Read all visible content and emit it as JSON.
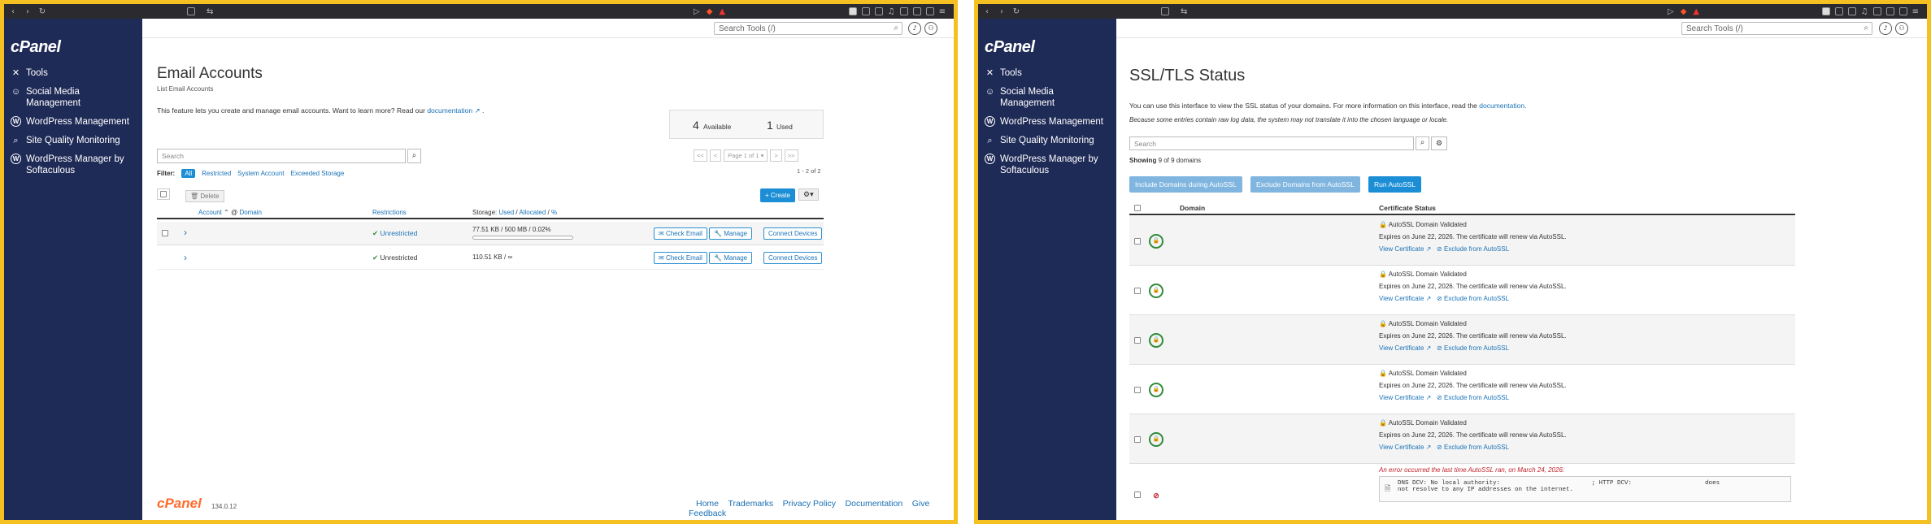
{
  "left": {
    "sidebar": {
      "logo": "cPanel",
      "items": [
        {
          "label": "Tools",
          "icon": "tools-icon"
        },
        {
          "label": "Social Media\nManagement",
          "icon": "social-icon"
        },
        {
          "label": "WordPress Management",
          "icon": "wordpress-icon"
        },
        {
          "label": "Site Quality Monitoring",
          "icon": "search-check-icon"
        },
        {
          "label": "WordPress Manager by\nSoftaculous",
          "icon": "wordpress-icon"
        }
      ]
    },
    "topbar": {
      "search_placeholder": "Search Tools (/)"
    },
    "page": {
      "title": "Email Accounts",
      "subtitle": "List Email Accounts",
      "intro": "This feature lets you create and manage email accounts. Want to learn more? Read our",
      "doc_link": "documentation",
      "stats": {
        "available_num": "4",
        "available_label": "Available",
        "used_num": "1",
        "used_label": "Used"
      },
      "search_placeholder": "Search",
      "pager": {
        "first": "<<",
        "prev": "<",
        "page": "Page 1 of 1",
        "next": ">",
        "last": ">>",
        "range": "1 - 2 of 2"
      },
      "filter_label": "Filter:",
      "filters": [
        "All",
        "Restricted",
        "System Account",
        "Exceeded Storage"
      ],
      "delete_label": "Delete",
      "create_label": "+ Create",
      "columns": {
        "account": "Account",
        "at": "@",
        "domain": "Domain",
        "restrictions": "Restrictions",
        "storage": "Storage:",
        "used": "Used",
        "allocated": "Allocated",
        "pct": "%"
      },
      "rows": [
        {
          "restriction": "Unrestricted",
          "storage": "77.51 KB / 500 MB / 0.02%",
          "has_checkbox": true
        },
        {
          "restriction": "Unrestricted",
          "storage": "110.51 KB / ∞",
          "has_checkbox": false
        }
      ],
      "actions": {
        "check": "Check Email",
        "manage": "Manage",
        "connect": "Connect Devices"
      }
    },
    "footer": {
      "brand": "cPanel",
      "version": "134.0.12",
      "links": [
        "Home",
        "Trademarks",
        "Privacy Policy",
        "Documentation",
        "Give Feedback"
      ]
    }
  },
  "right": {
    "sidebar": {
      "logo": "cPanel",
      "items": [
        {
          "label": "Tools"
        },
        {
          "label": "Social Media\nManagement"
        },
        {
          "label": "WordPress Management"
        },
        {
          "label": "Site Quality Monitoring"
        },
        {
          "label": "WordPress Manager by\nSoftaculous"
        }
      ]
    },
    "topbar": {
      "search_placeholder": "Search Tools (/)"
    },
    "page": {
      "title": "SSL/TLS Status",
      "intro": "You can use this interface to view the SSL status of your domains. For more information on this interface, read the",
      "doc_link": "documentation",
      "note": "Because some entries contain raw log data, the system may not translate it into the chosen language or locale.",
      "search_placeholder": "Search",
      "showing": "Showing",
      "showing_rest": "9 of 9 domains",
      "buttons": [
        "Include Domains during AutoSSL",
        "Exclude Domains from AutoSSL",
        "Run AutoSSL"
      ],
      "col_domain": "Domain",
      "col_status": "Certificate Status",
      "validated": "AutoSSL Domain Validated",
      "expires": "Expires on June 22, 2026. The certificate will renew via AutoSSL.",
      "view_cert": "View Certificate",
      "exclude": "Exclude from AutoSSL",
      "error_note": "An error occurred the last time AutoSSL ran, on March 24, 2026:",
      "error_line1": "DNS DCV: No local authority:                         ; HTTP DCV:                    does",
      "error_line2": "not resolve to any IP addresses on the internet."
    }
  },
  "colors": {
    "sidebar": "#1f2b57",
    "accent": "#1b8ed6",
    "border": "#f5c022",
    "success": "#2e8b3a",
    "error": "#c0222a"
  }
}
